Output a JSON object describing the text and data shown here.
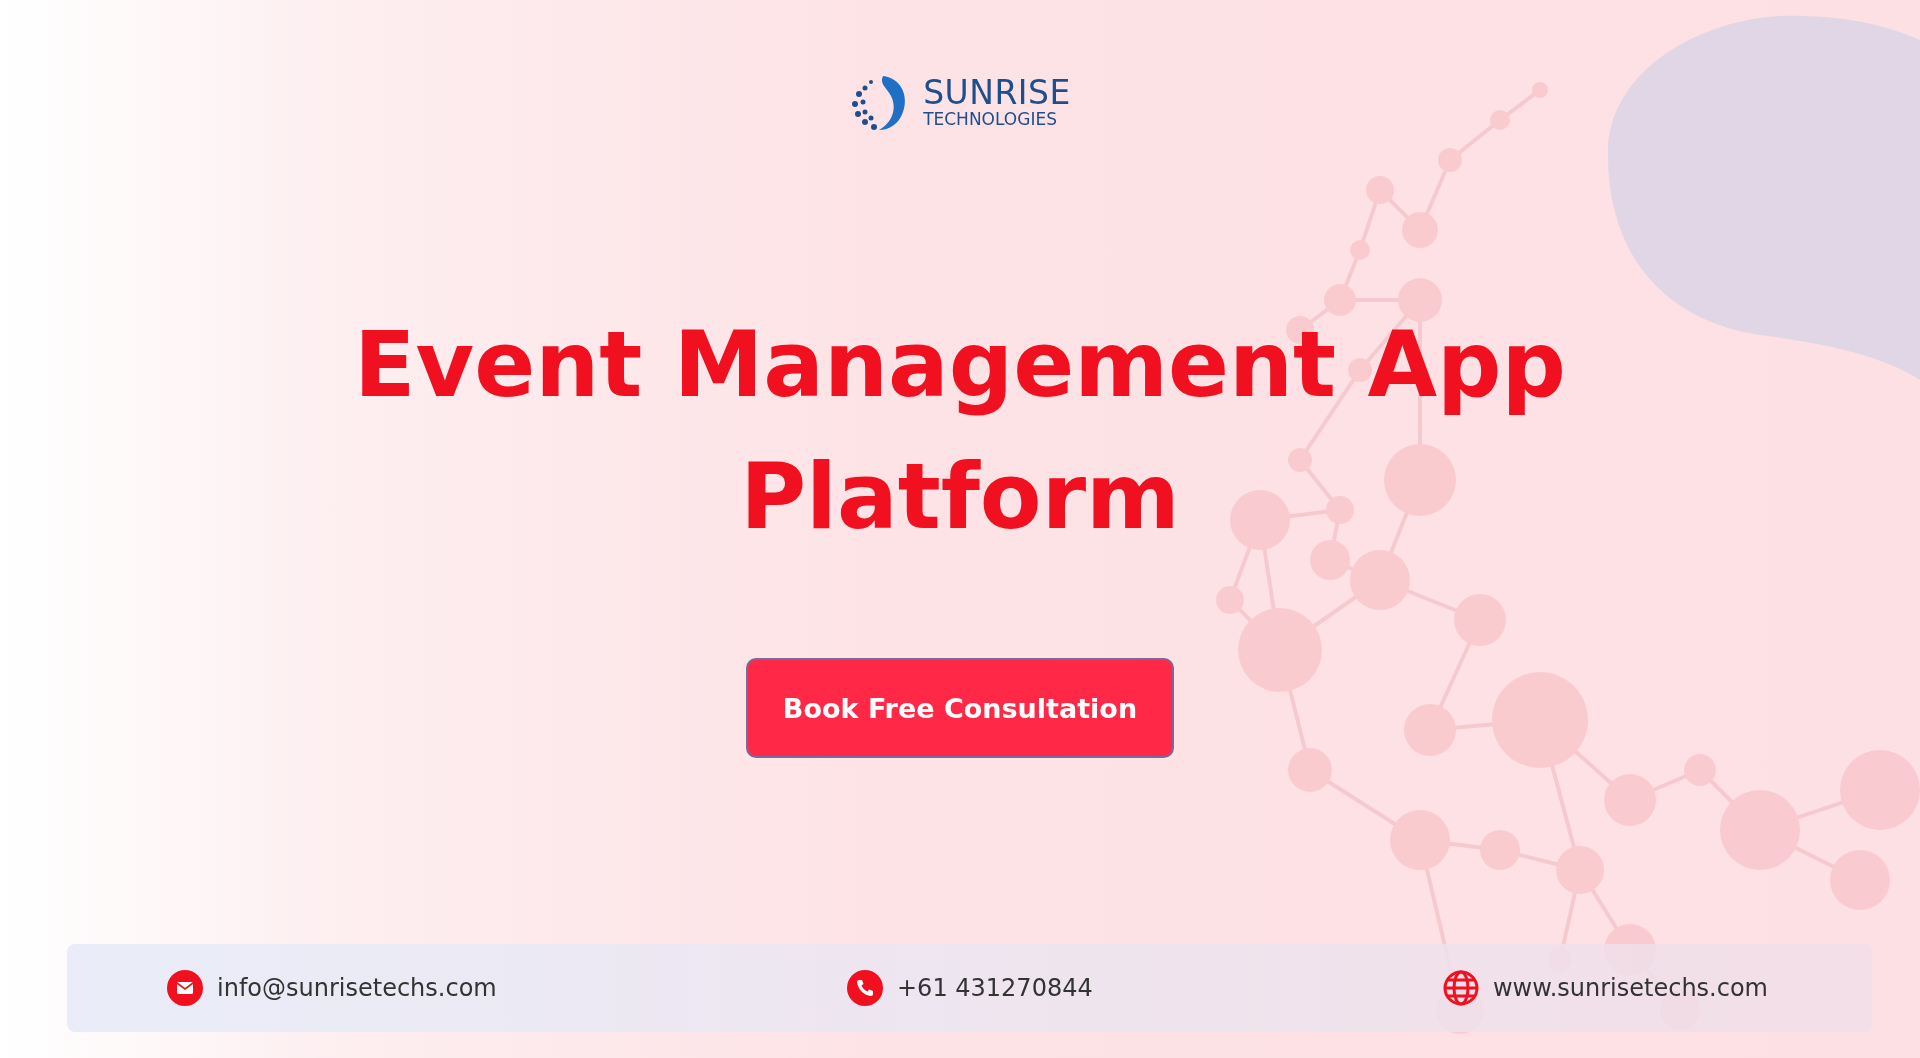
{
  "logo": {
    "name": "SUNRISE",
    "tagline": "TECHNOLOGIES"
  },
  "headline": [
    "Event Management App",
    "Platform"
  ],
  "cta": {
    "label": "Book Free Consultation"
  },
  "contacts": [
    {
      "kind": "email",
      "text": "info@sunrisetechs.com"
    },
    {
      "kind": "phone",
      "text": "+61 431270844"
    },
    {
      "kind": "web",
      "text": "www.sunrisetechs.com"
    }
  ]
}
